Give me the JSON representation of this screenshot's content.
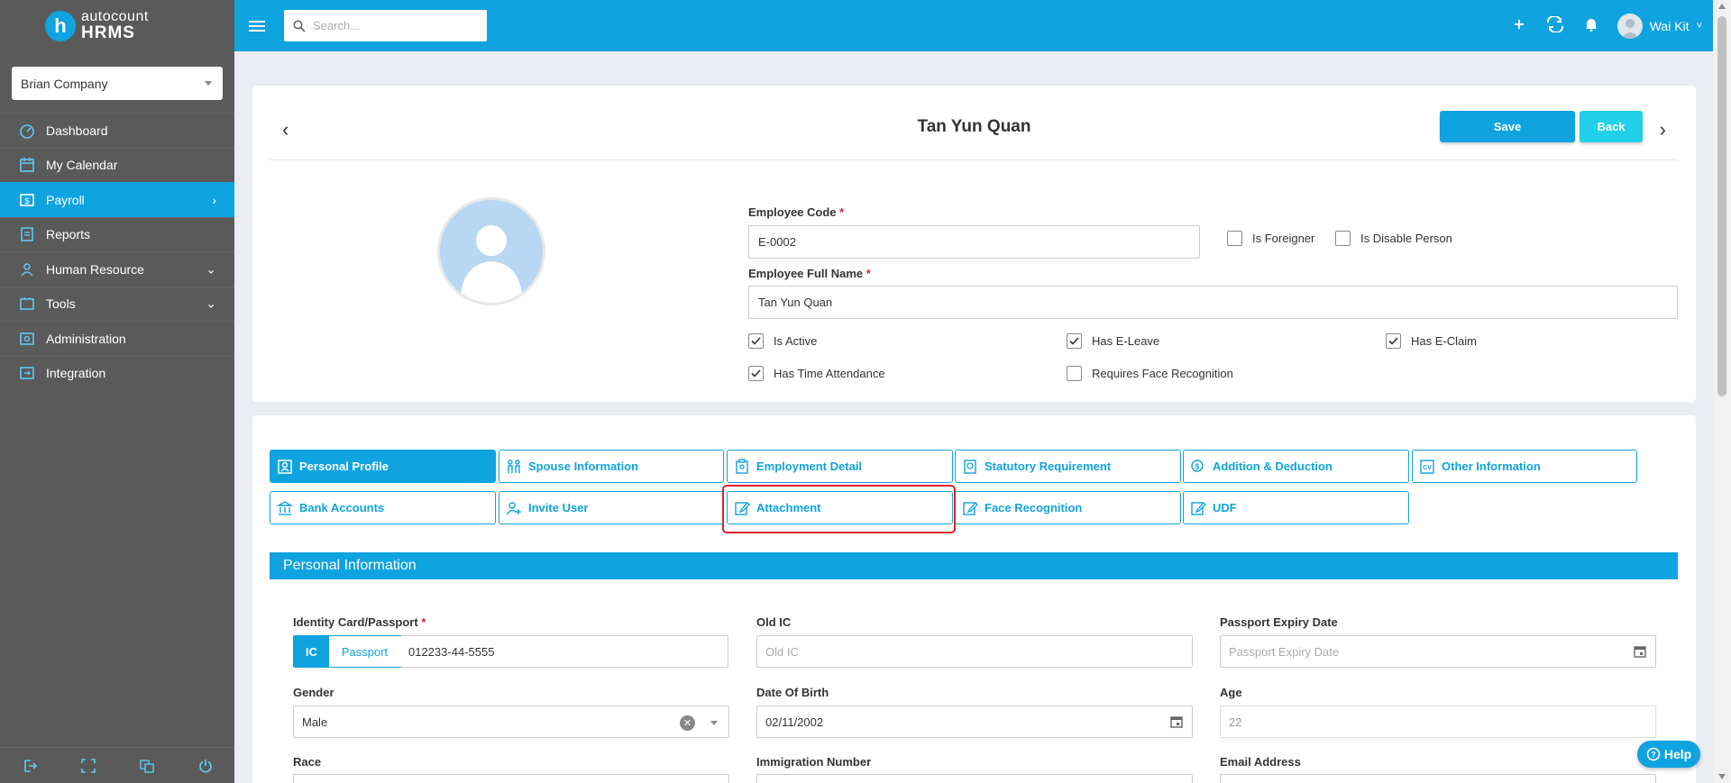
{
  "brand": {
    "top": "autocount",
    "bottom": "HRMS",
    "mark": "h"
  },
  "sidebar": {
    "company": "Brian Company",
    "items": [
      {
        "label": "Dashboard",
        "icon": "dashboard-icon"
      },
      {
        "label": "My Calendar",
        "icon": "calendar-icon"
      },
      {
        "label": "Payroll",
        "icon": "payroll-icon",
        "active": true
      },
      {
        "label": "Reports",
        "icon": "reports-icon"
      },
      {
        "label": "Human Resource",
        "icon": "human-resource-icon"
      },
      {
        "label": "Tools",
        "icon": "tools-icon"
      },
      {
        "label": "Administration",
        "icon": "administration-icon"
      },
      {
        "label": "Integration",
        "icon": "integration-icon"
      }
    ]
  },
  "topbar": {
    "search_placeholder": "Search...",
    "user_name": "Wai Kit"
  },
  "header": {
    "title": "Tan Yun Quan",
    "save_label": "Save",
    "back_label": "Back"
  },
  "employee": {
    "code_label": "Employee Code",
    "code_value": "E-0002",
    "name_label": "Employee Full Name",
    "name_value": "Tan Yun Quan",
    "is_foreigner": "Is Foreigner",
    "is_disable_person": "Is Disable Person",
    "is_active": "Is Active",
    "has_eleave": "Has E-Leave",
    "has_eclaim": "Has E-Claim",
    "has_time_attendance": "Has Time Attendance",
    "requires_face": "Requires Face Recognition"
  },
  "tabs": [
    "Personal Profile",
    "Spouse Information",
    "Employment Detail",
    "Statutory Requirement",
    "Addition & Deduction",
    "Other Information",
    "Bank Accounts",
    "Invite User",
    "Attachment",
    "Face Recognition",
    "UDF"
  ],
  "personal": {
    "section_title": "Personal Information",
    "ic_label": "Identity Card/Passport",
    "ic_btn": "IC",
    "passport_btn": "Passport",
    "ic_value": "012233-44-5555",
    "old_ic_label": "Old IC",
    "old_ic_placeholder": "Old IC",
    "passport_expiry_label": "Passport Expiry Date",
    "passport_expiry_placeholder": "Passport Expiry Date",
    "gender_label": "Gender",
    "gender_value": "Male",
    "dob_label": "Date Of Birth",
    "dob_value": "02/11/2002",
    "age_label": "Age",
    "age_value": "22",
    "race_label": "Race",
    "immigration_label": "Immigration Number",
    "email_label": "Email Address"
  },
  "help_label": "Help",
  "colors": {
    "primary": "#0fa3e0",
    "sidebar": "#5a5a5a",
    "back_button": "#20d0e8",
    "highlight": "#d9232e"
  }
}
